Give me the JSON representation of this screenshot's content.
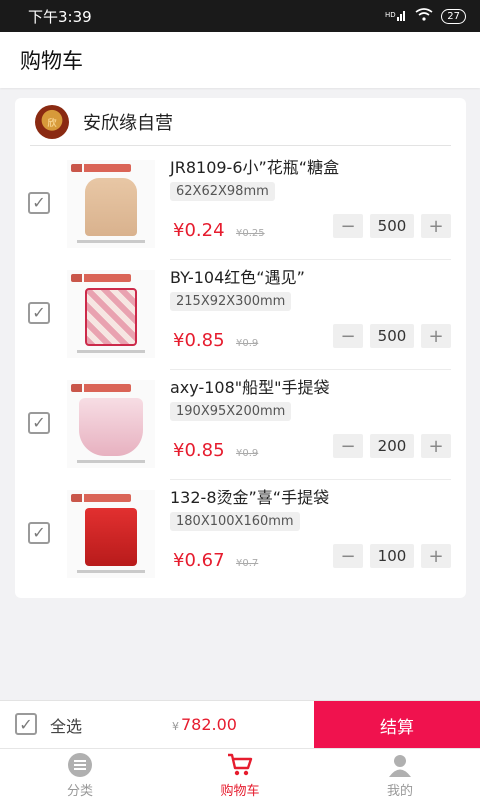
{
  "status_bar": {
    "time": "下午3:39",
    "signal": "HD",
    "battery": "27"
  },
  "header": {
    "title": "购物车"
  },
  "store": {
    "logo_text": "欣",
    "name": "安欣缘自营"
  },
  "items": [
    {
      "title": "JR8109-6小”花瓶“糖盒",
      "spec": "62X62X98mm",
      "price": "¥0.24",
      "old_price": "¥0.25",
      "quantity": "500",
      "checked": true
    },
    {
      "title": "BY-104红色“遇见”",
      "spec": "215X92X300mm",
      "price": "¥0.85",
      "old_price": "¥0.9",
      "quantity": "500",
      "checked": true
    },
    {
      "title": "axy-108\"船型\"手提袋",
      "spec": "190X95X200mm",
      "price": "¥0.85",
      "old_price": "¥0.9",
      "quantity": "200",
      "checked": true
    },
    {
      "title": "132-8烫金”喜“手提袋",
      "spec": "180X100X160mm",
      "price": "¥0.67",
      "old_price": "¥0.7",
      "quantity": "100",
      "checked": true
    }
  ],
  "stepper": {
    "minus": "−",
    "plus": "+"
  },
  "checkout": {
    "select_all": "全选",
    "currency": "¥",
    "total": "782.00",
    "pay_label": "结算",
    "checked": true
  },
  "tabs": [
    {
      "label": "分类",
      "icon": "menu-icon",
      "active": false
    },
    {
      "label": "购物车",
      "icon": "cart-icon",
      "active": true
    },
    {
      "label": "我的",
      "icon": "user-icon",
      "active": false
    }
  ],
  "colors": {
    "accent": "#e61c2e",
    "pay_button": "#f0124e"
  }
}
